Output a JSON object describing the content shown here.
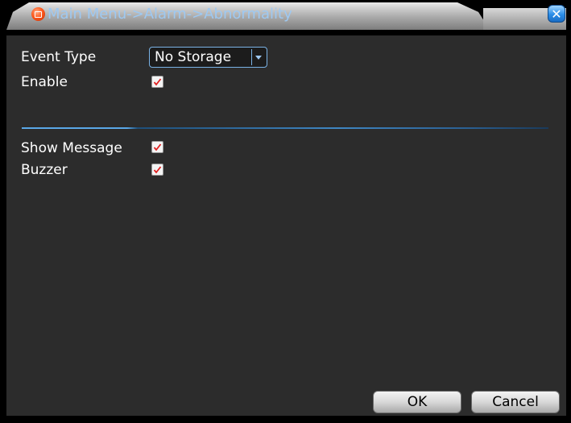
{
  "title": "Main Menu->Alarm->Abnormality",
  "fields": {
    "event_type_label": "Event Type",
    "event_type_value": "No Storage",
    "enable_label": "Enable",
    "enable_checked": true,
    "show_message_label": "Show Message",
    "show_message_checked": true,
    "buzzer_label": "Buzzer",
    "buzzer_checked": true
  },
  "buttons": {
    "ok": "OK",
    "cancel": "Cancel"
  },
  "icons": {
    "title_logo": "app-logo-icon",
    "close": "close-icon",
    "dropdown": "chevron-down-icon",
    "check": "check-icon"
  },
  "colors": {
    "title_text": "#9ec9f2",
    "panel_bg": "#2c2c2c",
    "check_mark": "#e02020",
    "accent_border": "#7ab3e6"
  }
}
